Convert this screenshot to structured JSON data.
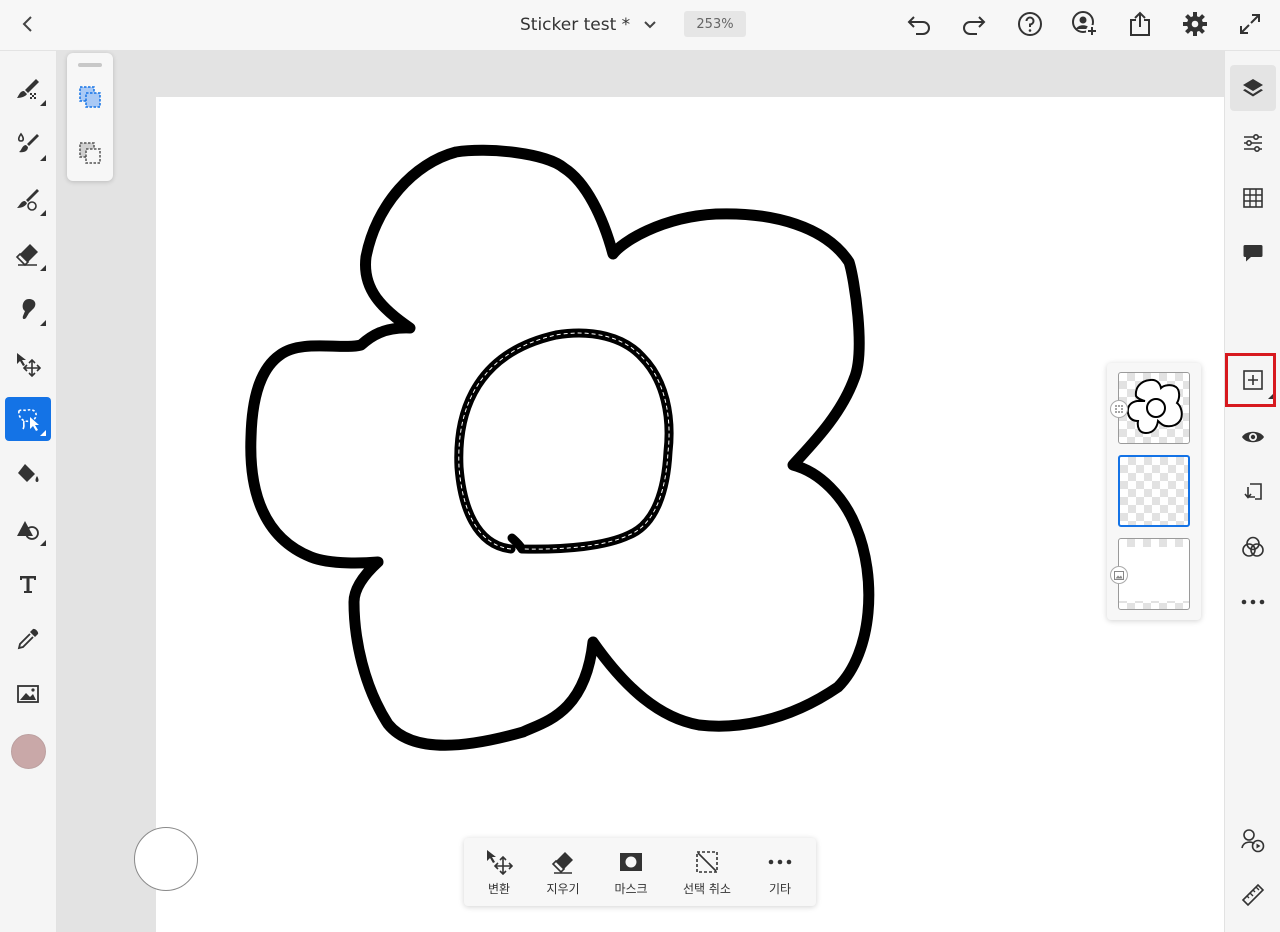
{
  "header": {
    "back": "chevron-left-icon",
    "document_title": "Sticker test *",
    "zoom": "253%",
    "actions": [
      "undo-icon",
      "redo-icon",
      "help-icon",
      "invite-user-icon",
      "share-icon",
      "settings-icon",
      "fullscreen-icon"
    ]
  },
  "left_toolbar": {
    "tools": [
      "paint-brush-icon",
      "mixer-brush-icon",
      "pixel-brush-icon",
      "eraser-icon",
      "smudge-icon",
      "move-icon",
      "lasso-select-icon",
      "fill-icon",
      "shape-icon",
      "type-icon",
      "eyedropper-icon",
      "place-image-icon"
    ],
    "active_tool": "lasso-select-icon",
    "color": "#c9a8a8"
  },
  "selection_modes": [
    "add-selection-icon",
    "subtract-selection-icon"
  ],
  "right_toolbar": {
    "items": [
      "layers-icon",
      "layer-properties-icon",
      "grid-icon",
      "comment-icon",
      "add-layer-icon",
      "visibility-eye-icon",
      "export-icon",
      "blend-mode-icon",
      "more-icon",
      "livestream-icon",
      "ruler-icon"
    ],
    "active": "layers-icon",
    "highlighted": "add-layer-icon"
  },
  "layers": [
    {
      "thumb": "flower-outline",
      "badge": "group-icon"
    },
    {
      "thumb": "empty",
      "selected": true
    },
    {
      "thumb": "white",
      "badge": "image-icon"
    }
  ],
  "taskbar": {
    "items": [
      {
        "label": "변환",
        "icon": "transform-icon"
      },
      {
        "label": "지우기",
        "icon": "eraser-icon"
      },
      {
        "label": "마스크",
        "icon": "mask-icon"
      },
      {
        "label": "선택 취소",
        "icon": "deselect-icon"
      },
      {
        "label": "기타",
        "icon": "more-icon"
      }
    ]
  }
}
